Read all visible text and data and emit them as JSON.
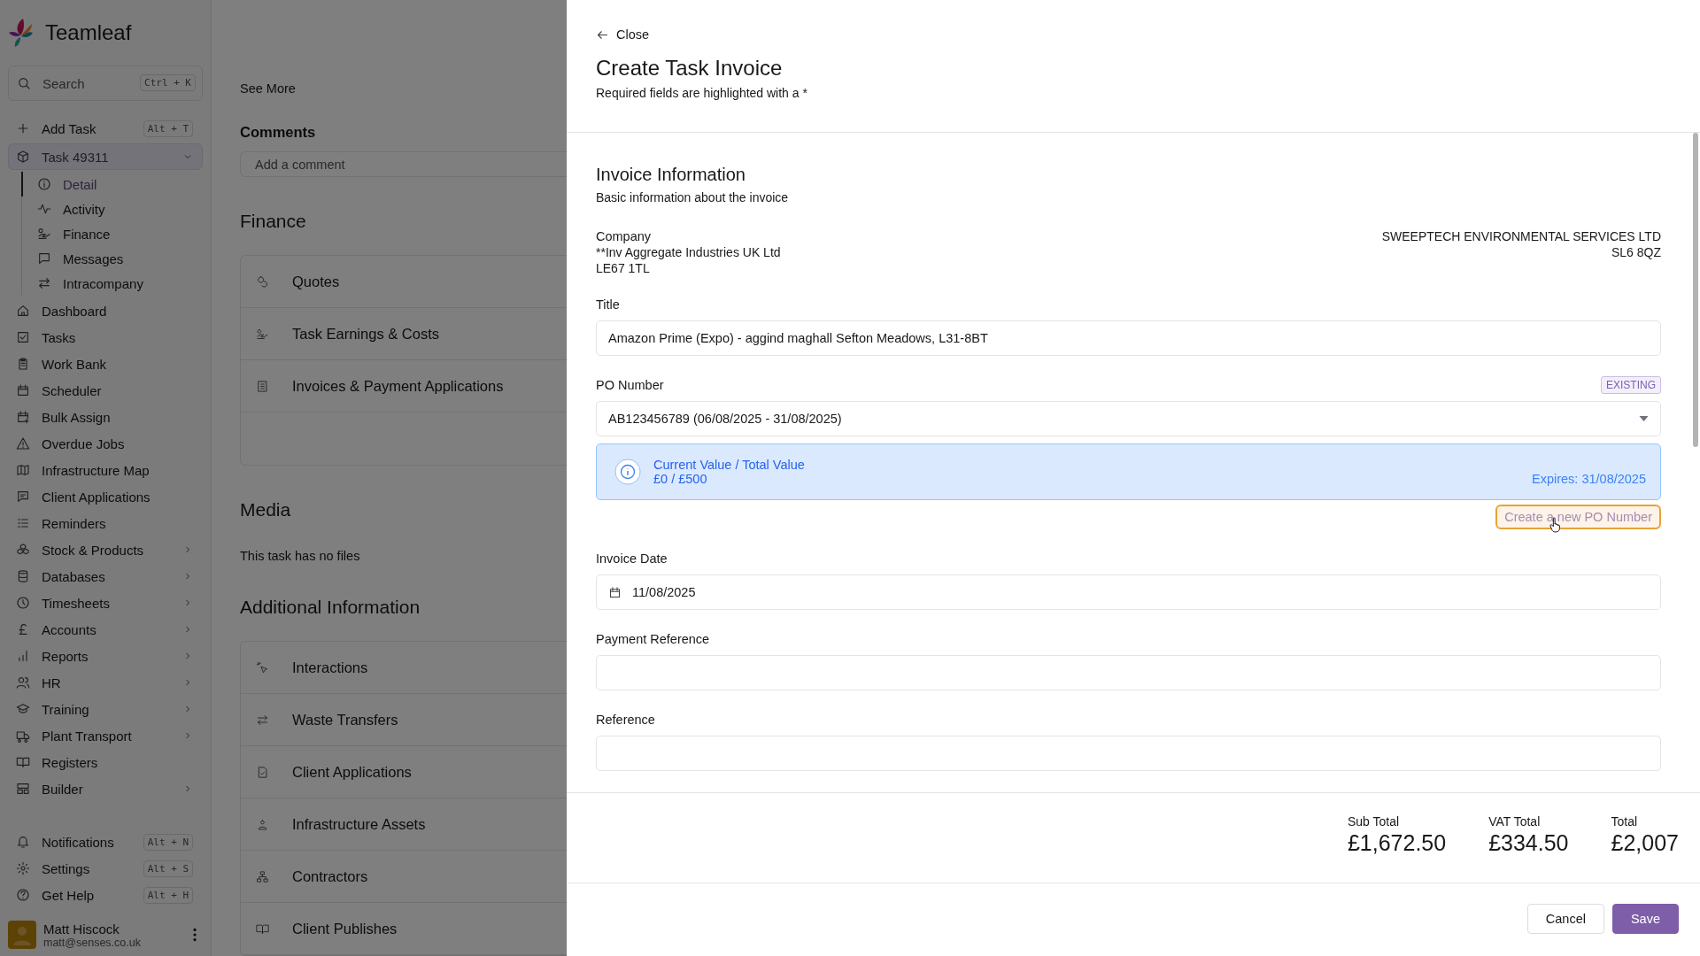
{
  "sidebar": {
    "brand": "Teamleaf",
    "search": {
      "placeholder": "Search",
      "shortcut": "Ctrl + K"
    },
    "add_task": {
      "label": "Add Task",
      "shortcut": "Alt + T"
    },
    "task": {
      "label": "Task 49311",
      "expanded": true,
      "children": [
        {
          "label": "Detail",
          "selected": true
        },
        {
          "label": "Activity",
          "selected": false
        },
        {
          "label": "Finance",
          "selected": false
        },
        {
          "label": "Messages",
          "selected": false
        },
        {
          "label": "Intracompany",
          "selected": false
        }
      ]
    },
    "items": [
      {
        "label": "Dashboard",
        "has_submenu": false
      },
      {
        "label": "Tasks",
        "has_submenu": false
      },
      {
        "label": "Work Bank",
        "has_submenu": false
      },
      {
        "label": "Scheduler",
        "has_submenu": false
      },
      {
        "label": "Bulk Assign",
        "has_submenu": false
      },
      {
        "label": "Overdue Jobs",
        "has_submenu": false
      },
      {
        "label": "Infrastructure Map",
        "has_submenu": false
      },
      {
        "label": "Client Applications",
        "has_submenu": false
      },
      {
        "label": "Reminders",
        "has_submenu": false
      },
      {
        "label": "Stock & Products",
        "has_submenu": true
      },
      {
        "label": "Databases",
        "has_submenu": true
      },
      {
        "label": "Timesheets",
        "has_submenu": true
      },
      {
        "label": "Accounts",
        "has_submenu": true
      },
      {
        "label": "Reports",
        "has_submenu": true
      },
      {
        "label": "HR",
        "has_submenu": true
      },
      {
        "label": "Training",
        "has_submenu": true
      },
      {
        "label": "Plant Transport",
        "has_submenu": true
      },
      {
        "label": "Registers",
        "has_submenu": false
      },
      {
        "label": "Builder",
        "has_submenu": true
      }
    ],
    "bottom_items": [
      {
        "label": "Notifications",
        "shortcut": "Alt + N"
      },
      {
        "label": "Settings",
        "shortcut": "Alt + S"
      },
      {
        "label": "Get Help",
        "shortcut": "Alt + H"
      }
    ],
    "user": {
      "name": "Matt Hiscock",
      "email": "matt@senses.co.uk"
    }
  },
  "task_detail": {
    "see_more": "See More",
    "comments": {
      "title": "Comments",
      "placeholder": "Add a comment"
    },
    "finance": {
      "title": "Finance",
      "items": [
        "Quotes",
        "Task Earnings & Costs",
        "Invoices & Payment Applications"
      ]
    },
    "media": {
      "title": "Media",
      "empty_text": "This task has no files"
    },
    "additional": {
      "title": "Additional Information",
      "items": [
        "Interactions",
        "Waste Transfers",
        "Client Applications",
        "Infrastructure Assets",
        "Contractors",
        "Client Publishes"
      ]
    }
  },
  "invoice_panel": {
    "close": "Close",
    "title": "Create Task Invoice",
    "subtitle": "Required fields are highlighted with a *",
    "section": {
      "title": "Invoice Information",
      "subtitle": "Basic information about the invoice"
    },
    "company": {
      "label": "Company",
      "lines": [
        "**Inv Aggregate Industries UK Ltd",
        "LE67 1TL"
      ],
      "supplier_lines": [
        "SWEEPTECH ENVIRONMENTAL SERVICES LTD",
        "SL6 8QZ"
      ]
    },
    "fields": [
      {
        "kind": "text",
        "label": "Title",
        "value": "Amazon Prime (Expo) - aggind maghall Sefton Meadows, L31-8BT"
      },
      {
        "kind": "select",
        "label": "PO Number",
        "badge": "EXISTING",
        "value": "AB123456789 (06/08/2025 - 31/08/2025)",
        "info": {
          "title": "Current Value / Total Value",
          "value": "£0 / £500",
          "expires": "Expires: 31/08/2025"
        },
        "create_button": "Create a new PO Number"
      },
      {
        "kind": "date",
        "label": "Invoice Date",
        "value": "11/08/2025"
      },
      {
        "kind": "text",
        "label": "Payment Reference"
      },
      {
        "kind": "text",
        "label": "Reference"
      }
    ],
    "totals": [
      {
        "label": "Sub Total",
        "value": "£1,672.50"
      },
      {
        "label": "VAT Total",
        "value": "£334.50"
      },
      {
        "label": "Total",
        "value": "£2,007"
      }
    ],
    "buttons": {
      "cancel": "Cancel",
      "save": "Save"
    }
  }
}
